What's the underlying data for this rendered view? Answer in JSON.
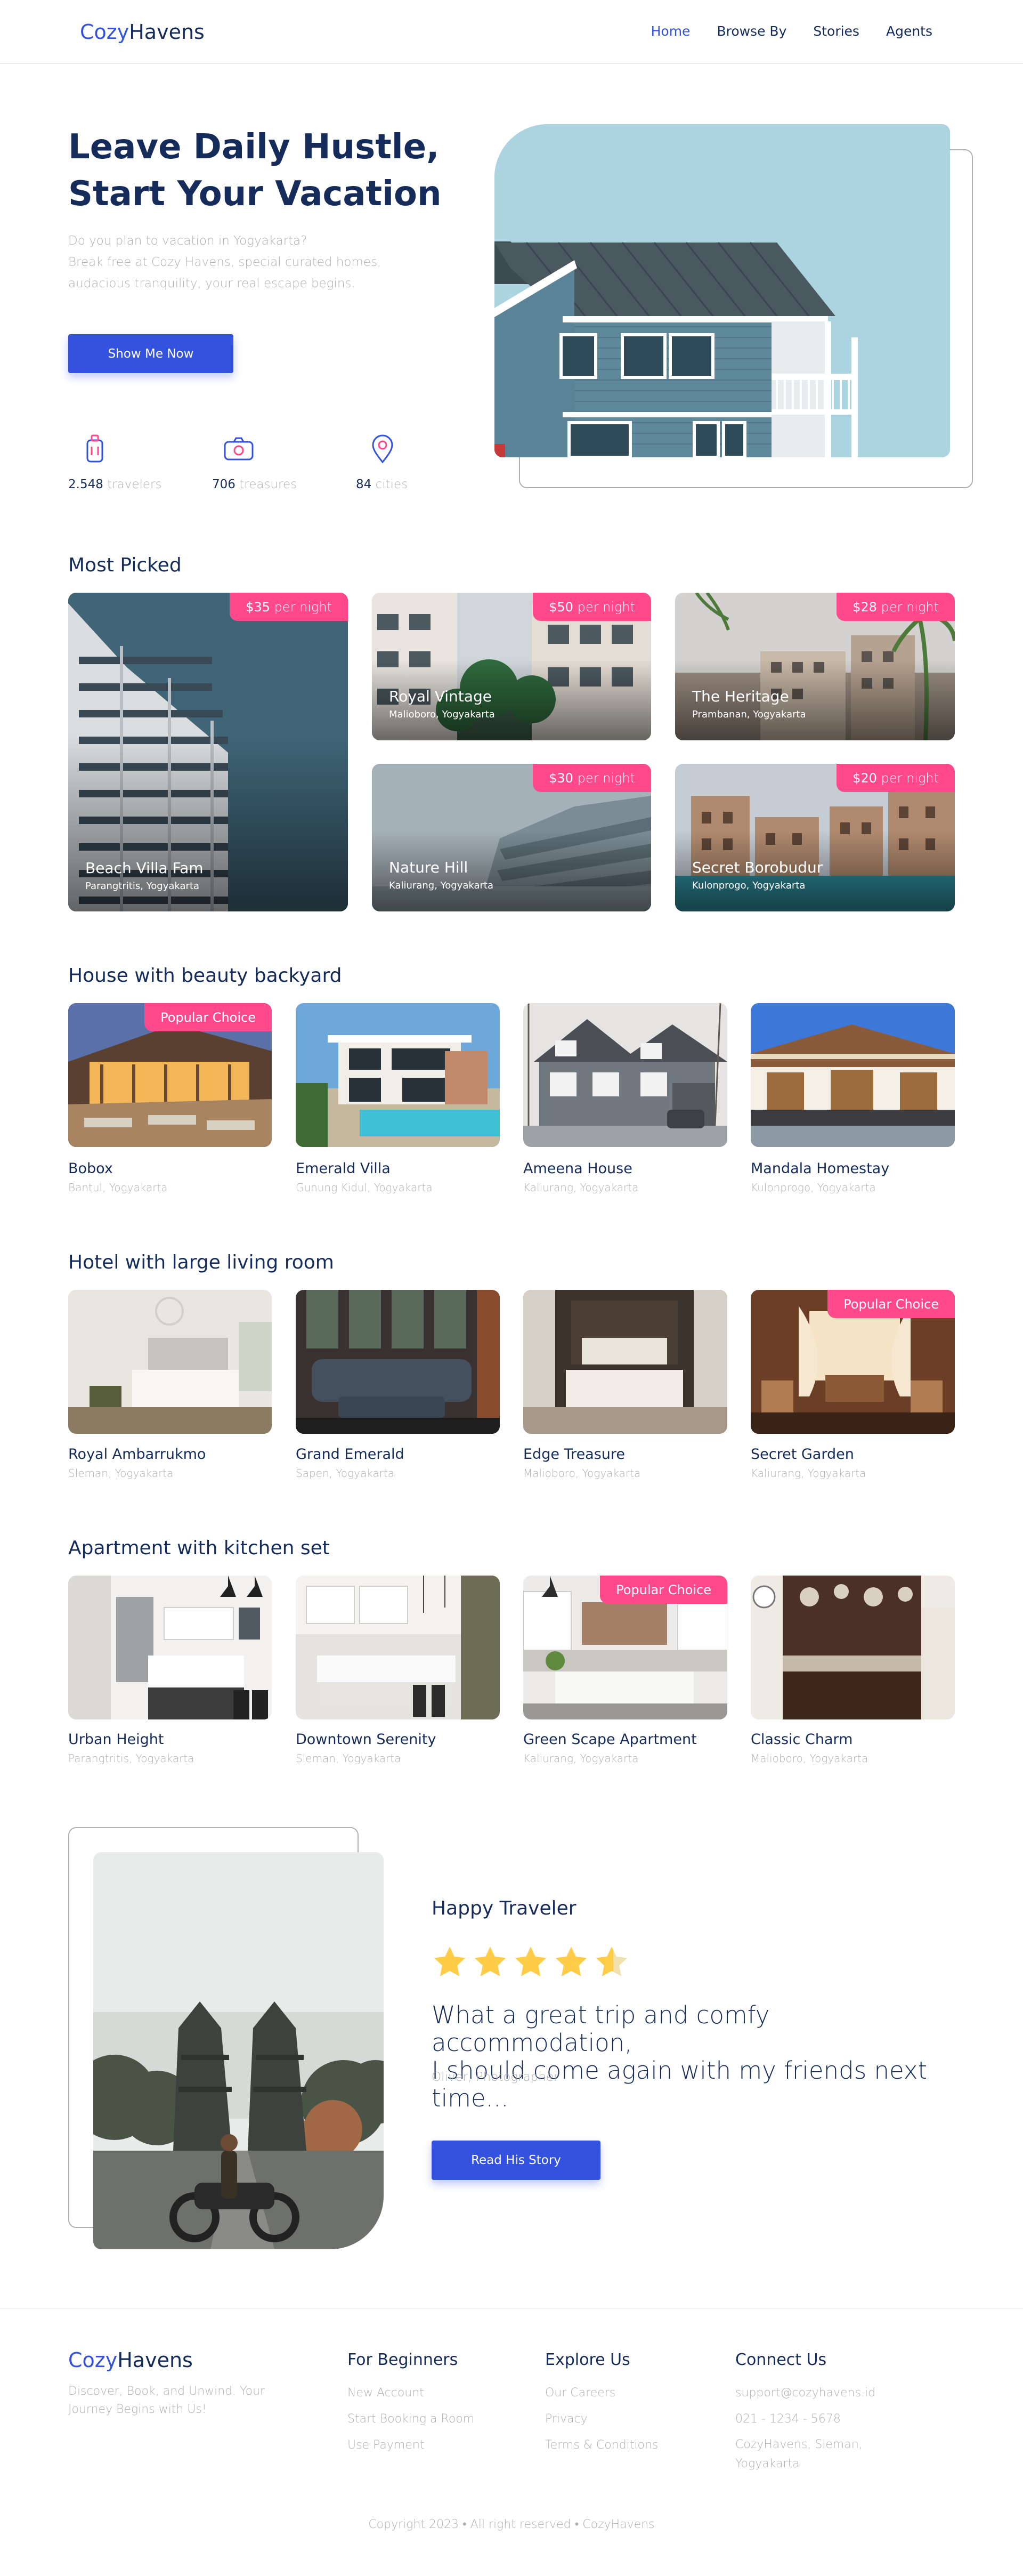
{
  "header": {
    "logo_a": "Cozy",
    "logo_b": "Havens",
    "nav": [
      "Home",
      "Browse By",
      "Stories",
      "Agents"
    ]
  },
  "hero": {
    "title_line1": "Leave Daily Hustle,",
    "title_line2": "Start Your Vacation",
    "subtitle_line1": "Do you plan to vacation in Yogyakarta?",
    "subtitle_line2": "Break free at Cozy Havens, special curated homes,",
    "subtitle_line3": "audacious tranquility, your real escape begins.",
    "button": "Show Me Now",
    "stats": [
      {
        "value": "2.548",
        "label": "travelers",
        "icon": "suitcase-icon"
      },
      {
        "value": "706",
        "label": "treasures",
        "icon": "camera-icon"
      },
      {
        "value": "84",
        "label": "cities",
        "icon": "location-pin-icon"
      }
    ]
  },
  "most_picked": {
    "title": "Most Picked",
    "items": [
      {
        "price": "$35",
        "unit": "per night",
        "name": "Beach Villa Fam",
        "location": "Parangtritis, Yogyakarta"
      },
      {
        "price": "$50",
        "unit": "per night",
        "name": "Royal Vintage",
        "location": "Malioboro, Yogyakarta"
      },
      {
        "price": "$28",
        "unit": "per night",
        "name": "The Heritage",
        "location": "Prambanan, Yogyakarta"
      },
      {
        "price": "$30",
        "unit": "per night",
        "name": "Nature Hill",
        "location": "Kaliurang, Yogyakarta"
      },
      {
        "price": "$20",
        "unit": "per night",
        "name": "Secret Borobudur",
        "location": "Kulonprogo, Yogyakarta"
      }
    ]
  },
  "categories": [
    {
      "title": "House with beauty backyard",
      "items": [
        {
          "name": "Bobox",
          "location": "Bantul, Yogyakarta",
          "tag": "Popular Choice"
        },
        {
          "name": "Emerald Villa",
          "location": "Gunung Kidul, Yogyakarta",
          "tag": ""
        },
        {
          "name": "Ameena House",
          "location": "Kaliurang, Yogyakarta",
          "tag": ""
        },
        {
          "name": "Mandala Homestay",
          "location": "Kulonprogo, Yogyakarta",
          "tag": ""
        }
      ]
    },
    {
      "title": "Hotel with large living room",
      "items": [
        {
          "name": "Royal Ambarrukmo",
          "location": "Sleman, Yogyakarta",
          "tag": ""
        },
        {
          "name": "Grand Emerald",
          "location": "Sapen, Yogyakarta",
          "tag": ""
        },
        {
          "name": "Edge Treasure",
          "location": "Malioboro, Yogyakarta",
          "tag": ""
        },
        {
          "name": "Secret Garden",
          "location": "Kaliurang, Yogyakarta",
          "tag": "Popular Choice"
        }
      ]
    },
    {
      "title": "Apartment with kitchen set",
      "items": [
        {
          "name": "Urban Height",
          "location": "Parangtritis, Yogyakarta",
          "tag": ""
        },
        {
          "name": "Downtown Serenity",
          "location": "Sleman, Yogyakarta",
          "tag": ""
        },
        {
          "name": "Green Scape Apartment",
          "location": "Kaliurang, Yogyakarta",
          "tag": "Popular Choice"
        },
        {
          "name": "Classic Charm",
          "location": "Malioboro, Yogyakarta",
          "tag": ""
        }
      ]
    }
  ],
  "testimonial": {
    "title": "Happy Traveler",
    "rating": 4.5,
    "quote_line1": "What a great trip and comfy accommodation,",
    "quote_line2": "I should come again with my friends next time...",
    "author": "Oliver, Photographer",
    "button": "Read His Story"
  },
  "footer": {
    "logo_a": "Cozy",
    "logo_b": "Havens",
    "description": "Discover, Book, and Unwind. Your Journey Begins with Us!",
    "col1": {
      "title": "For Beginners",
      "links": [
        "New Account",
        "Start Booking a Room",
        "Use Payment"
      ]
    },
    "col2": {
      "title": "Explore Us",
      "links": [
        "Our Careers",
        "Privacy",
        "Terms & Conditions"
      ]
    },
    "col3": {
      "title": "Connect Us",
      "links": [
        "support@cozyhavens.id",
        "021 - 1234 - 5678",
        "CozyHavens, Sleman, Yogyakarta"
      ]
    },
    "copyright": "Copyright 2023 • All right reserved • CozyHavens"
  },
  "colors": {
    "primary": "#3252df",
    "navy": "#152c5b",
    "pink": "#ff498b",
    "gray": "#b0b0b0",
    "star": "#ffcc47"
  }
}
